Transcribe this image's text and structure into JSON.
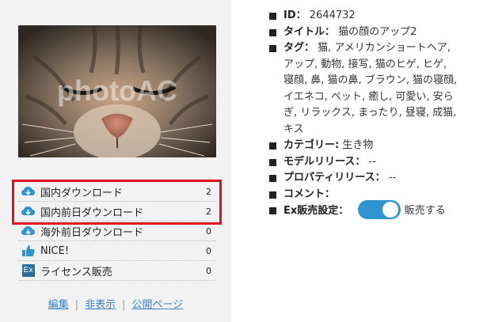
{
  "photo": {
    "watermark": "photoAC"
  },
  "stats": [
    {
      "label": "国内ダウンロード",
      "count": "2",
      "icon": "cloud-download-icon"
    },
    {
      "label": "国内前日ダウンロード",
      "count": "2",
      "icon": "cloud-download-icon"
    },
    {
      "label": "海外前日ダウンロード",
      "count": "0",
      "icon": "cloud-download-icon"
    },
    {
      "label": "NICE!",
      "count": "0",
      "icon": "thumbs-up-icon"
    },
    {
      "label": "ライセンス販売",
      "count": "0",
      "icon": "ex-icon",
      "icon_text": "Ex"
    }
  ],
  "footer": {
    "edit": "編集",
    "hide": "非表示",
    "public_page": "公開ページ",
    "separator": "|"
  },
  "info": {
    "id_key": "ID：",
    "id_val": "2644732",
    "title_key": "タイトル：",
    "title_val": "猫の顔のアップ2",
    "tags_key": "タグ：",
    "tags_val": "猫, アメリカンショートヘア, アップ, 動物, 接写, 猫のヒゲ, ヒゲ, 寝顔, 鼻, 猫の鼻, ブラウン, 猫の寝顔, イエネコ, ペット, 癒し, 可愛い, 安らぎ, リラックス, まったり, 昼寝, 成猫, キス",
    "category_key": "カテゴリー:",
    "category_val": "生き物",
    "model_key": "モデルリリース：",
    "model_val": "--",
    "property_key": "プロパティリリース：",
    "property_val": "--",
    "comment_key": "コメント：",
    "ex_key": "Ex販売設定：",
    "ex_val": "販売する"
  },
  "colors": {
    "accent": "#2f93cf",
    "highlight": "#e10f1f",
    "link": "#3b82c6",
    "panel_bg": "#f2f2f2"
  }
}
